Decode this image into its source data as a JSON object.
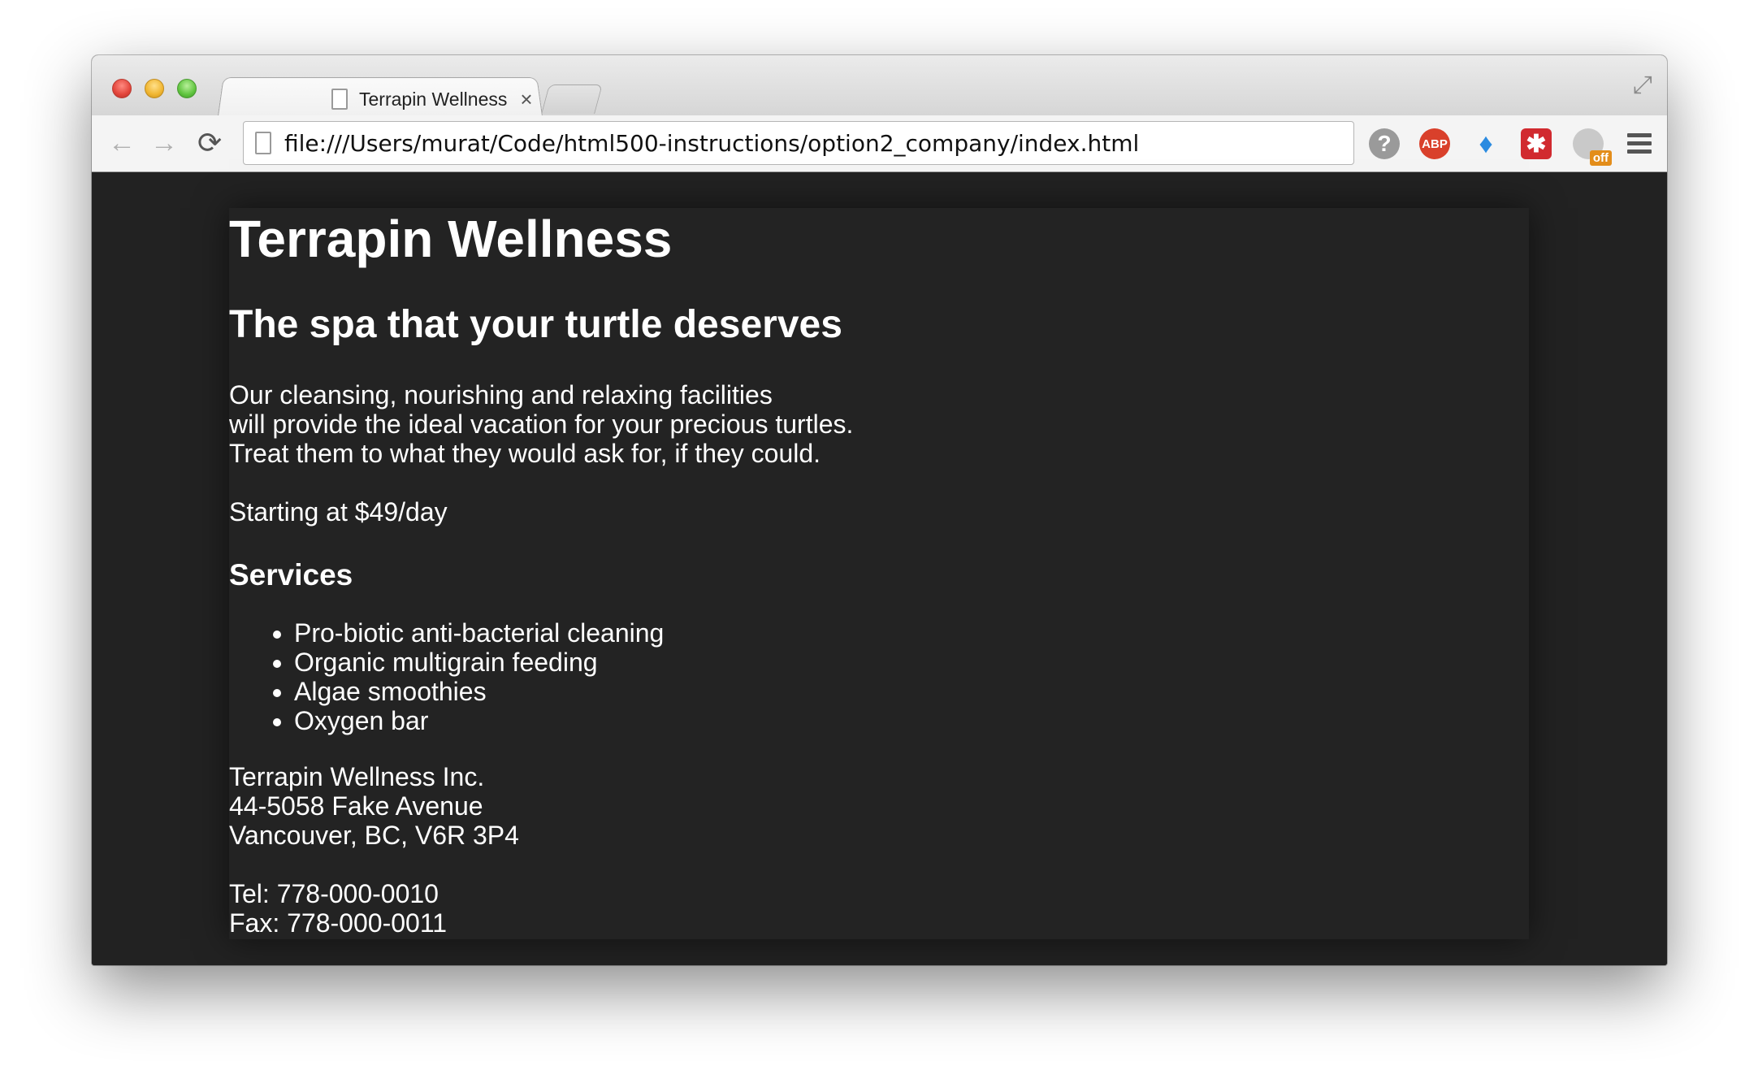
{
  "browser": {
    "tab_title": "Terrapin Wellness",
    "tab_close": "×",
    "url": "file:///Users/murat/Code/html500-instructions/option2_company/index.html",
    "nav": {
      "back": "←",
      "forward": "→",
      "reload": "⟳"
    },
    "extensions": [
      {
        "name": "help-icon",
        "glyph": "?"
      },
      {
        "name": "adblock-plus-icon",
        "glyph": "ABP"
      },
      {
        "name": "gem-icon",
        "glyph": "♦"
      },
      {
        "name": "lastpass-icon",
        "glyph": "✱"
      },
      {
        "name": "off-extension-icon",
        "glyph": "",
        "badge": "off"
      }
    ],
    "fullscreen_glyph": "⤢"
  },
  "page": {
    "title": "Terrapin Wellness",
    "tagline": "The spa that your turtle deserves",
    "intro": [
      "Our cleansing, nourishing and relaxing facilities",
      "will provide the ideal vacation for your precious turtles.",
      "Treat them to what they would ask for, if they could."
    ],
    "price": "Starting at $49/day",
    "services_heading": "Services",
    "services": [
      "Pro-biotic anti-bacterial cleaning",
      "Organic multigrain feeding",
      "Algae smoothies",
      "Oxygen bar"
    ],
    "address": [
      "Terrapin Wellness Inc.",
      "44-5058 Fake Avenue",
      "Vancouver, BC, V6R 3P4"
    ],
    "contact": [
      "Tel: 778-000-0010",
      "Fax: 778-000-0011"
    ]
  },
  "colors": {
    "page_background": "#222222",
    "content_background": "#232323",
    "text": "#ffffff"
  }
}
